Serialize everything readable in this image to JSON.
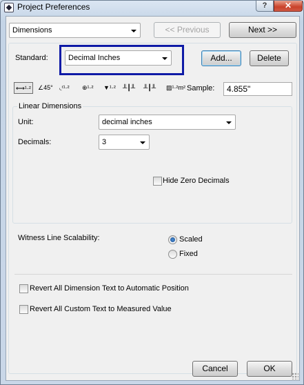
{
  "window": {
    "title": "Project Preferences",
    "help_glyph": "?",
    "close_glyph": "✕"
  },
  "nav": {
    "category": "Dimensions",
    "previous_label": "<< Previous",
    "next_label": "Next >>"
  },
  "standard": {
    "label": "Standard:",
    "value": "Decimal Inches",
    "add_label": "Add...",
    "delete_label": "Delete",
    "highlight_color": "#0e1aa6"
  },
  "toolbar": {
    "tools": [
      {
        "icon": "linear-dimension-icon",
        "glyph": "⟷¹·²"
      },
      {
        "icon": "angular-dimension-icon",
        "glyph": "∠45°"
      },
      {
        "icon": "radial-dimension-icon",
        "glyph": "◟ʳ¹·²"
      },
      {
        "icon": "level-dimension-icon",
        "glyph": "⊕¹·²"
      },
      {
        "icon": "elevation-dimension-icon",
        "glyph": "▼¹·²"
      },
      {
        "icon": "door-window-dimension-icon",
        "glyph": "╨┃╨"
      },
      {
        "icon": "sill-height-dimension-icon",
        "glyph": "╨┃╨"
      },
      {
        "icon": "area-dimension-icon",
        "glyph": "▨¹·²m²"
      }
    ],
    "sample_label": "Sample:",
    "sample_value": "4.855\""
  },
  "linear": {
    "group_title": "Linear Dimensions",
    "unit_label": "Unit:",
    "unit_value": "decimal inches",
    "decimals_label": "Decimals:",
    "decimals_value": "3",
    "hide_zero_label": "Hide Zero Decimals"
  },
  "witness": {
    "label": "Witness Line Scalability:",
    "scaled_label": "Scaled",
    "fixed_label": "Fixed",
    "selected": "Scaled"
  },
  "options": {
    "revert_dimension_label": "Revert All Dimension Text to Automatic Position",
    "revert_custom_label": "Revert All Custom Text to Measured Value"
  },
  "footer": {
    "cancel_label": "Cancel",
    "ok_label": "OK"
  }
}
